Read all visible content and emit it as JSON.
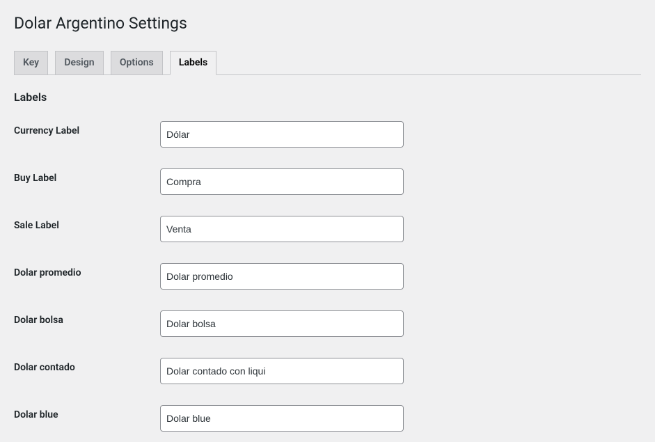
{
  "page": {
    "title": "Dolar Argentino Settings"
  },
  "tabs": {
    "items": [
      {
        "label": "Key",
        "active": false
      },
      {
        "label": "Design",
        "active": false
      },
      {
        "label": "Options",
        "active": false
      },
      {
        "label": "Labels",
        "active": true
      }
    ]
  },
  "section": {
    "title": "Labels"
  },
  "fields": {
    "currency_label": {
      "label": "Currency Label",
      "value": "Dólar"
    },
    "buy_label": {
      "label": "Buy Label",
      "value": "Compra"
    },
    "sale_label": {
      "label": "Sale Label",
      "value": "Venta"
    },
    "dolar_promedio": {
      "label": "Dolar promedio",
      "value": "Dolar promedio"
    },
    "dolar_bolsa": {
      "label": "Dolar bolsa",
      "value": "Dolar bolsa"
    },
    "dolar_contado": {
      "label": "Dolar contado",
      "value": "Dolar contado con liqui"
    },
    "dolar_blue": {
      "label": "Dolar blue",
      "value": "Dolar blue"
    }
  }
}
